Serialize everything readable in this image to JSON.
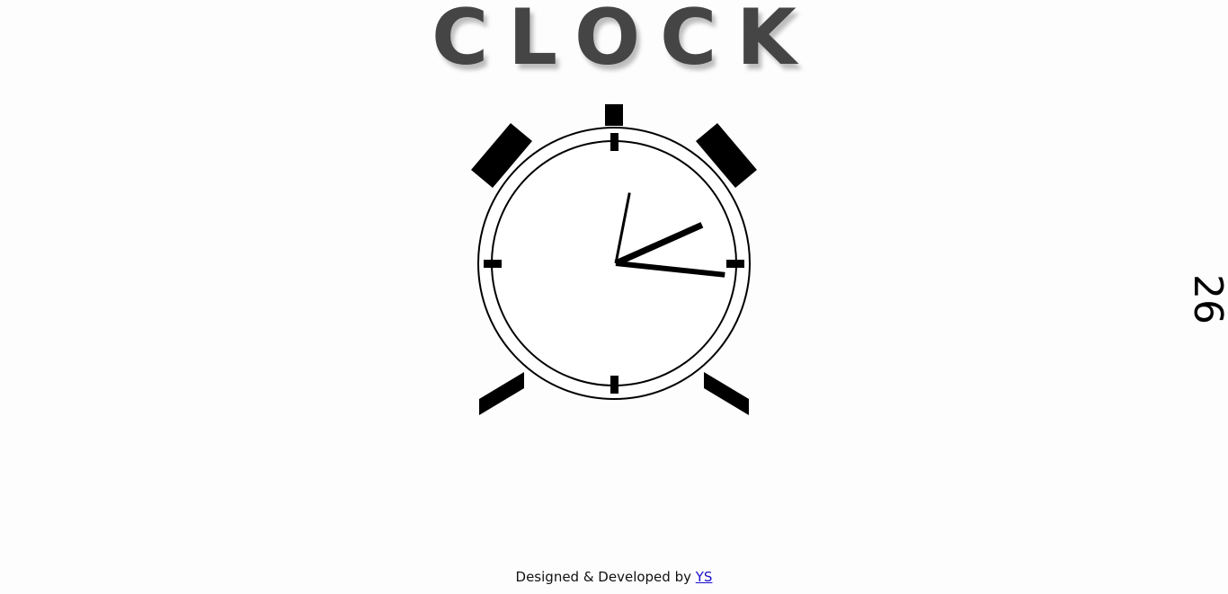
{
  "header": {
    "title": "CLOCK"
  },
  "clock": {
    "hour_hand_deg": 66,
    "minute_hand_deg": 96,
    "second_hand_deg": 11,
    "color": "#000000"
  },
  "side_counter": {
    "value": "26"
  },
  "footer": {
    "text": "Designed & Developed by",
    "link_label": "YS",
    "link_color": "#1a0dcc"
  }
}
